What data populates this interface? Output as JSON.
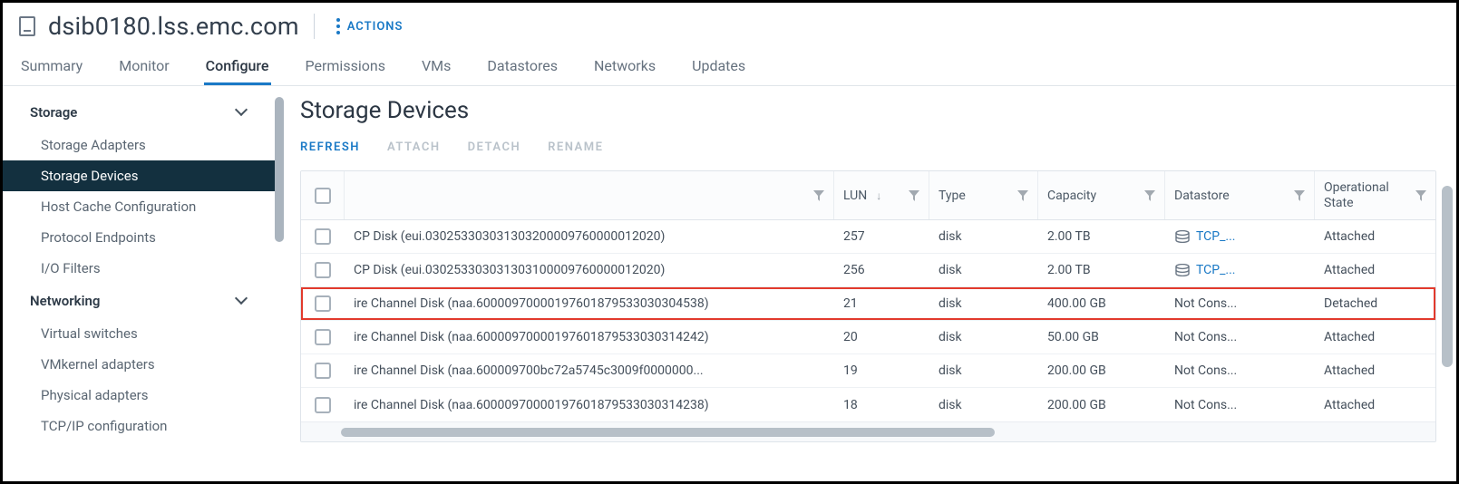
{
  "header": {
    "title": "dsib0180.lss.emc.com",
    "actions_label": "ACTIONS"
  },
  "primary_tabs": {
    "items": [
      "Summary",
      "Monitor",
      "Configure",
      "Permissions",
      "VMs",
      "Datastores",
      "Networks",
      "Updates"
    ],
    "active_index": 2
  },
  "sidebar": {
    "groups": [
      {
        "label": "Storage",
        "expanded": true,
        "items": [
          "Storage Adapters",
          "Storage Devices",
          "Host Cache Configuration",
          "Protocol Endpoints",
          "I/O Filters"
        ],
        "active_index": 1
      },
      {
        "label": "Networking",
        "expanded": true,
        "items": [
          "Virtual switches",
          "VMkernel adapters",
          "Physical adapters",
          "TCP/IP configuration"
        ],
        "active_index": -1
      }
    ]
  },
  "main": {
    "title": "Storage Devices",
    "actions": [
      {
        "label": "REFRESH",
        "enabled": true
      },
      {
        "label": "ATTACH",
        "enabled": false
      },
      {
        "label": "DETACH",
        "enabled": false
      },
      {
        "label": "RENAME",
        "enabled": false
      }
    ],
    "columns": {
      "name": "",
      "lun": "LUN",
      "type": "Type",
      "capacity": "Capacity",
      "datastore": "Datastore",
      "op_state": "Operational State"
    },
    "rows": [
      {
        "name": "CP Disk (eui.030253303031303200009760000012020)",
        "lun": "257",
        "type": "disk",
        "capacity": "2.00 TB",
        "datastore": "TCP_...",
        "datastore_link": true,
        "op_state": "Attached",
        "highlight": false
      },
      {
        "name": "CP Disk (eui.030253303031303100009760000012020)",
        "lun": "256",
        "type": "disk",
        "capacity": "2.00 TB",
        "datastore": "TCP_...",
        "datastore_link": true,
        "op_state": "Attached",
        "highlight": false
      },
      {
        "name": "ire Channel Disk (naa.60000970000197601879533030304538)",
        "lun": "21",
        "type": "disk",
        "capacity": "400.00 GB",
        "datastore": "Not Cons...",
        "datastore_link": false,
        "op_state": "Detached",
        "highlight": true
      },
      {
        "name": "ire Channel Disk (naa.60000970000197601879533030314242)",
        "lun": "20",
        "type": "disk",
        "capacity": "50.00 GB",
        "datastore": "Not Cons...",
        "datastore_link": false,
        "op_state": "Attached",
        "highlight": false
      },
      {
        "name": "ire Channel Disk (naa.600009700bc72a5745c3009f0000000...",
        "lun": "19",
        "type": "disk",
        "capacity": "200.00 GB",
        "datastore": "Not Cons...",
        "datastore_link": false,
        "op_state": "Attached",
        "highlight": false
      },
      {
        "name": "ire Channel Disk (naa.60000970000197601879533030314238)",
        "lun": "18",
        "type": "disk",
        "capacity": "200.00 GB",
        "datastore": "Not Cons...",
        "datastore_link": false,
        "op_state": "Attached",
        "highlight": false
      }
    ]
  }
}
